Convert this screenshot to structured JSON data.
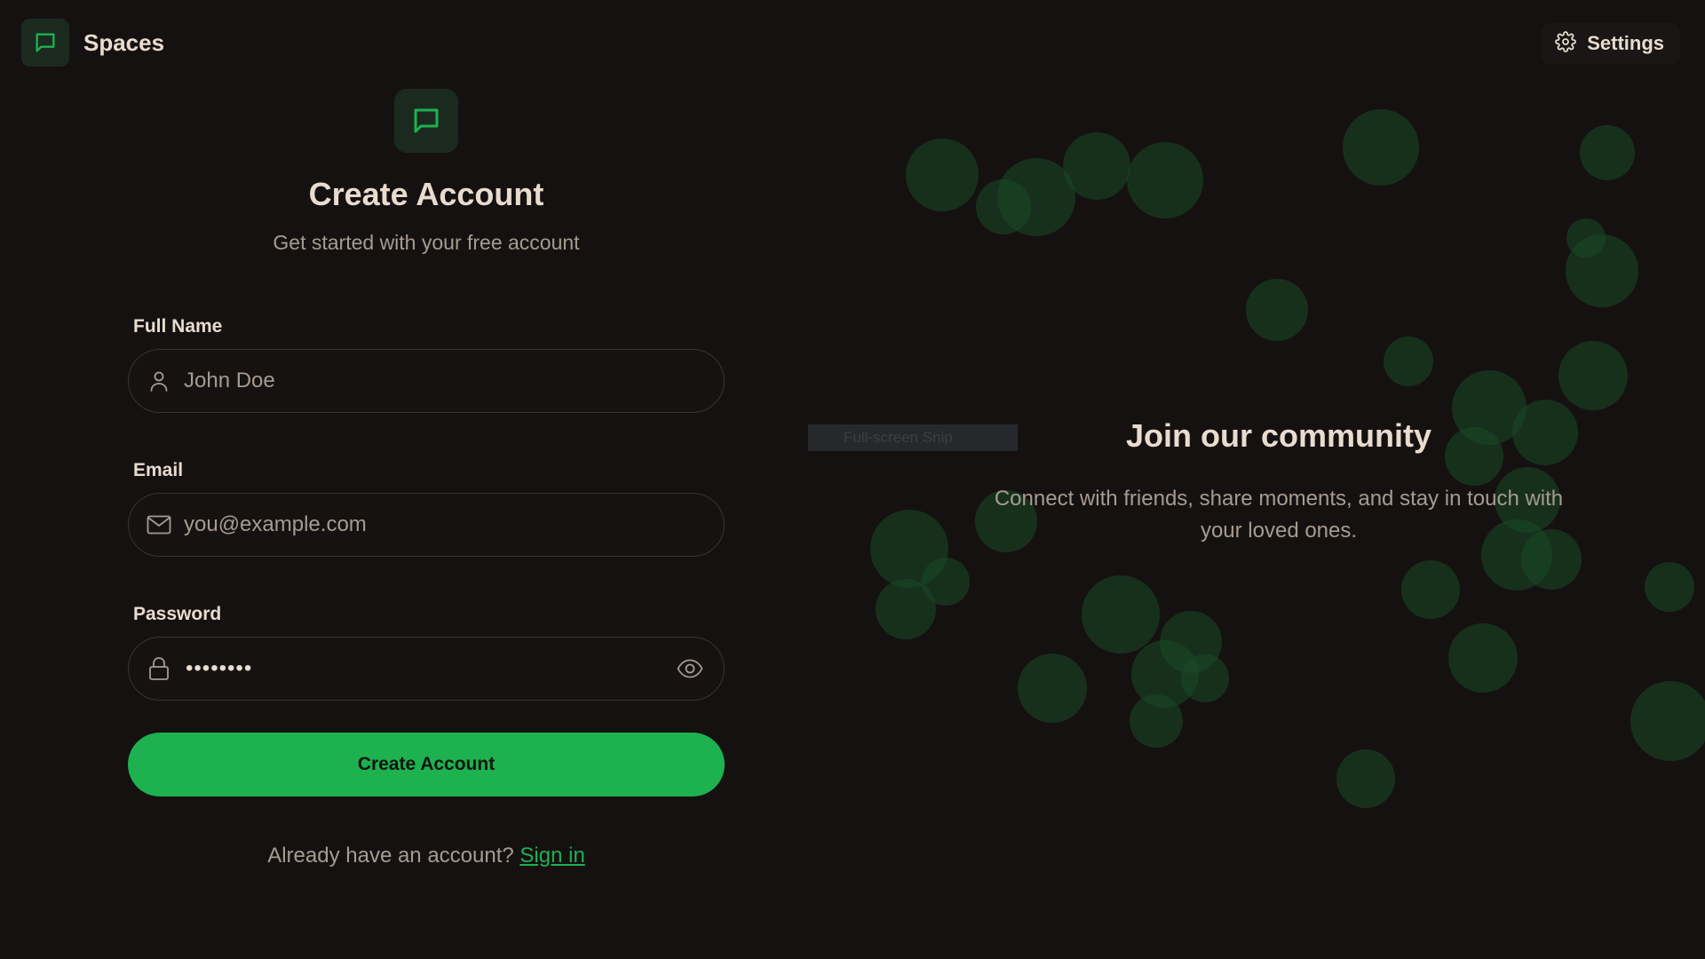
{
  "app": {
    "name": "Spaces",
    "accent_color": "#1db14f"
  },
  "header": {
    "brand_icon": "message-square-icon",
    "settings_label": "Settings",
    "settings_icon": "gear-icon"
  },
  "form": {
    "hero_icon": "message-square-icon",
    "title": "Create Account",
    "subtitle": "Get started with your free account",
    "fields": {
      "full_name": {
        "label": "Full Name",
        "placeholder": "John Doe",
        "icon": "user-icon"
      },
      "email": {
        "label": "Email",
        "placeholder": "you@example.com",
        "icon": "mail-icon"
      },
      "password": {
        "label": "Password",
        "masked_value": "••••••••",
        "icon": "lock-icon",
        "toggle_icon": "eye-icon"
      }
    },
    "submit_label": "Create Account",
    "signin_prompt": "Already have an account?",
    "signin_link": "Sign in"
  },
  "community": {
    "title": "Join our community",
    "description": "Connect with friends, share moments, and stay in touch with your loved ones."
  },
  "overlay": {
    "snip_label": "Full-screen Snip"
  }
}
